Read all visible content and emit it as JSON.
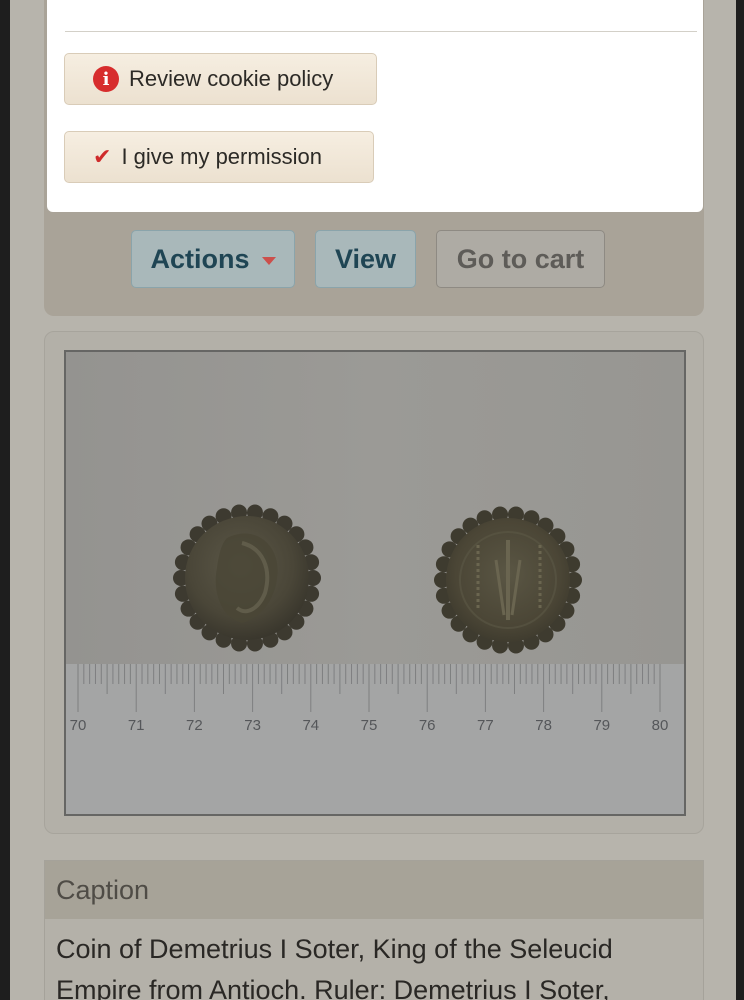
{
  "cookie_banner": {
    "review_policy_label": "Review cookie policy",
    "permission_label": "I give my permission",
    "info_icon": "info-circle-icon",
    "check_icon": "checkmark-icon"
  },
  "toolbar": {
    "actions_label": "Actions",
    "view_label": "View",
    "cart_label": "Go to cart"
  },
  "photo": {
    "ruler_labels": [
      "70",
      "71",
      "72",
      "73",
      "74",
      "75",
      "76",
      "77",
      "78",
      "79",
      "80"
    ]
  },
  "caption": {
    "heading": "Caption",
    "text": "Coin of Demetrius I Soter, King of the Seleucid Empire from Antioch. Ruler: Demetrius I Soter,"
  },
  "colors": {
    "accent_red": "#d72d2d",
    "button_blue_text": "#1f4554"
  }
}
